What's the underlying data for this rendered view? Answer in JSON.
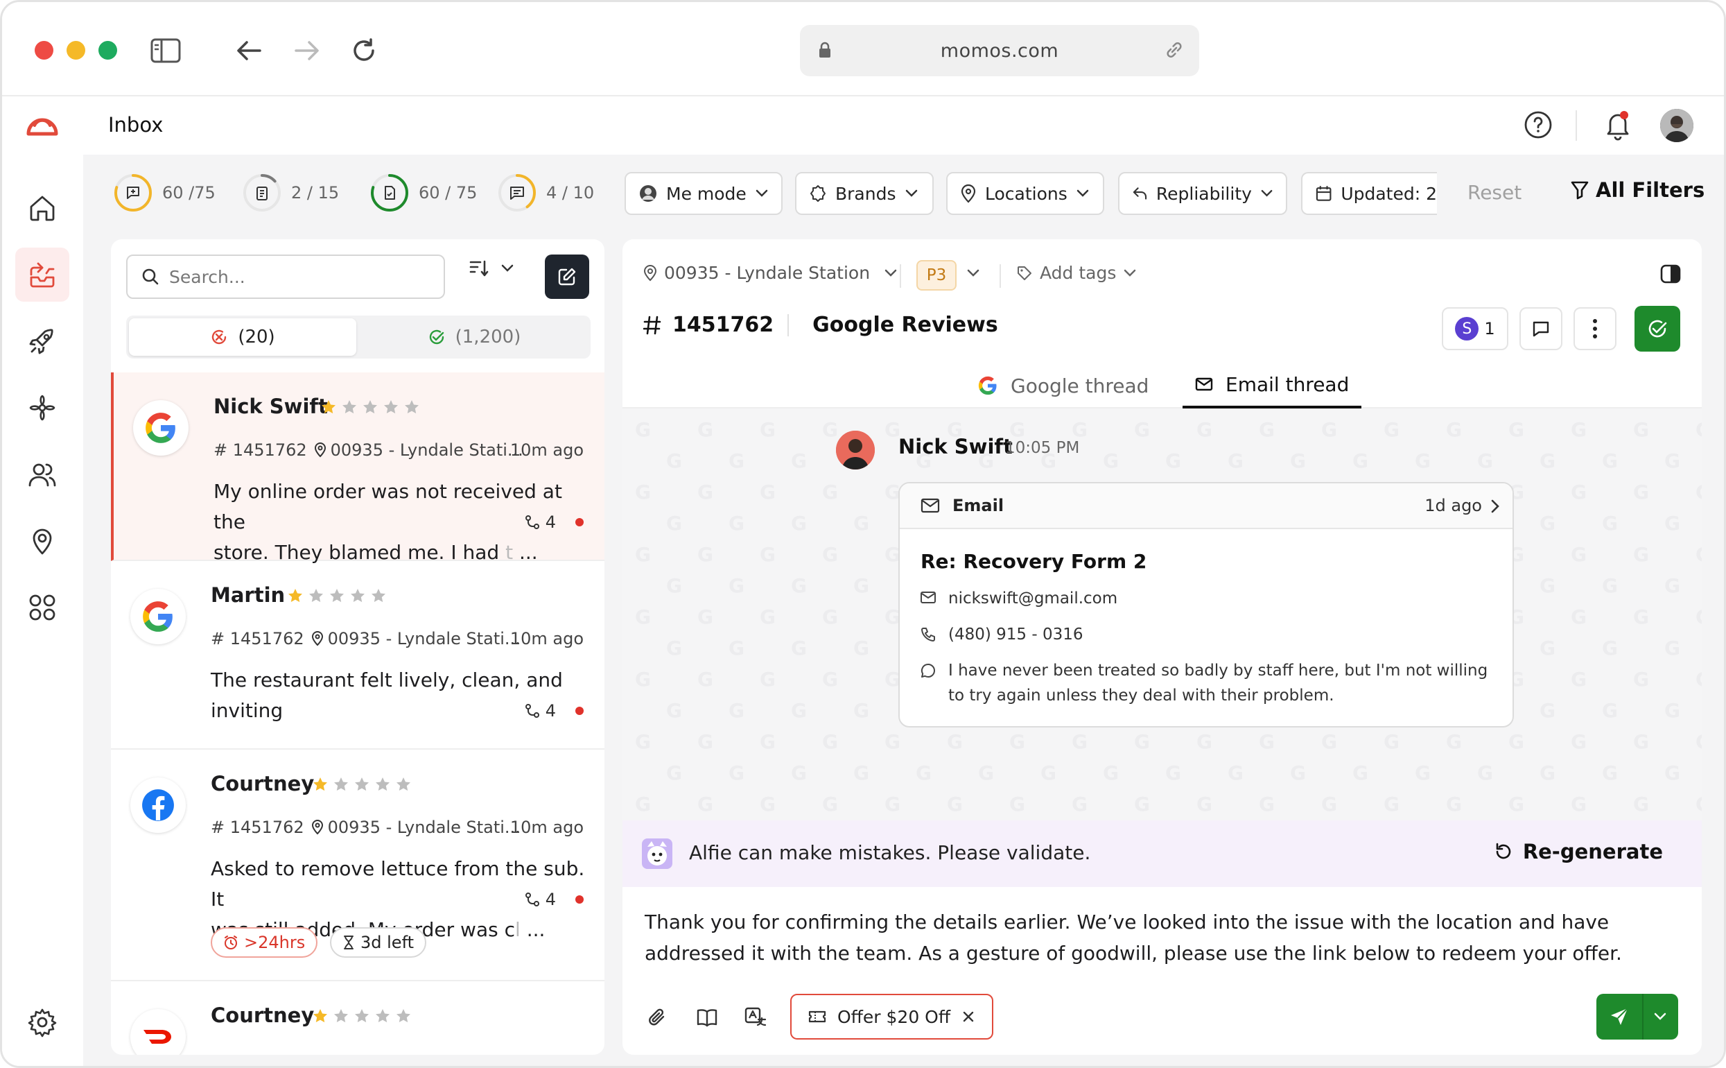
{
  "browser": {
    "url": "momos.com"
  },
  "header": {
    "title": "Inbox"
  },
  "colors": {
    "brand": "#e14a3b",
    "success": "#1e8a2c",
    "dark": "#1f252e",
    "ai_bg": "#f6f0fb"
  },
  "sidebar": {
    "items": [
      {
        "icon": "home-icon"
      },
      {
        "icon": "inbox-icon",
        "active": true
      },
      {
        "icon": "rocket-icon"
      },
      {
        "icon": "flower-icon"
      },
      {
        "icon": "users-icon"
      },
      {
        "icon": "location-pin-icon"
      },
      {
        "icon": "apps-grid-icon"
      }
    ],
    "settings_icon": "gear-icon"
  },
  "counters": [
    {
      "label": "60 /75",
      "value": 60,
      "max": 75,
      "color": "#f2b52a",
      "icon": "chat-plus-icon"
    },
    {
      "label": "2 / 15",
      "value": 2,
      "max": 15,
      "color": "#7a7a7a",
      "icon": "clipboard-icon"
    },
    {
      "label": "60 / 75",
      "value": 60,
      "max": 75,
      "color": "#1e8a2c",
      "icon": "file-check-icon"
    },
    {
      "label": "4 / 10",
      "value": 4,
      "max": 10,
      "color": "#f2b52a",
      "icon": "comment-icon"
    }
  ],
  "filters": {
    "me_mode": "Me mode",
    "brands": "Brands",
    "locations": "Locations",
    "repliability": "Repliability",
    "updated": "Updated: 2",
    "reset": "Reset",
    "all_filters": "All Filters"
  },
  "list": {
    "search_placeholder": "Search...",
    "tabs": [
      {
        "label": "(20)",
        "icon": "x-circle-icon"
      },
      {
        "label": "(1,200)",
        "icon": "check-circle-icon"
      }
    ],
    "items": [
      {
        "source": "google",
        "name": "Nick Swift",
        "rating": 1,
        "id": "# 1451762",
        "location": "00935 - Lyndale Stati...",
        "time": "10m ago",
        "text_1": "My online order was not received at the",
        "text_2": "store. They blamed me. I had",
        "text_faded": "t",
        "ellipsis": "...",
        "count": "4",
        "selected": true
      },
      {
        "source": "google",
        "name": "Martin",
        "rating": 1,
        "id": "# 1451762",
        "location": "00935 - Lyndale Stati...",
        "time": "10m ago",
        "text_1": "The restaurant felt lively, clean, and",
        "text_2": "inviting",
        "count": "4"
      },
      {
        "source": "facebook",
        "name": "Courtney",
        "rating": 1,
        "id": "# 1451762",
        "location": "00935 - Lyndale Stati...",
        "time": "10m ago",
        "text_1": "Asked to remove lettuce from the sub. It",
        "text_2": "was still added. My order was c",
        "text_faded": "l",
        "ellipsis": "...",
        "count": "4",
        "badge_overdue": ">24hrs",
        "badge_left": "3d left"
      },
      {
        "source": "doordash",
        "name": "Courtney",
        "rating": 1
      }
    ]
  },
  "detail": {
    "location": "00935 - Lyndale Station",
    "priority": "P3",
    "add_tags": "Add tags",
    "ticket_id": "1451762",
    "ticket_source": "Google Reviews",
    "assignee_initial": "S",
    "assignee_count": "1",
    "tabs": {
      "google": "Google thread",
      "email": "Email thread"
    },
    "message": {
      "sender": "Nick Swift",
      "time": "10:05 PM",
      "card_label": "Email",
      "card_ago": "1d ago",
      "subject": "Re: Recovery Form 2",
      "email": "nickswift@gmail.com",
      "phone": "(480) 915 - 0316",
      "body": "I have never been treated so badly by staff here, but I'm not willing to try again unless they deal with their problem."
    },
    "ai_notice": "Alfie can make mistakes. Please validate.",
    "regenerate": "Re-generate",
    "reply": "Thank you for confirming the details earlier. We’ve looked into the issue with the location and have addressed it with the team. As a gesture of goodwill, please use the link below to redeem your offer.",
    "offer": "Offer $20 Off"
  }
}
